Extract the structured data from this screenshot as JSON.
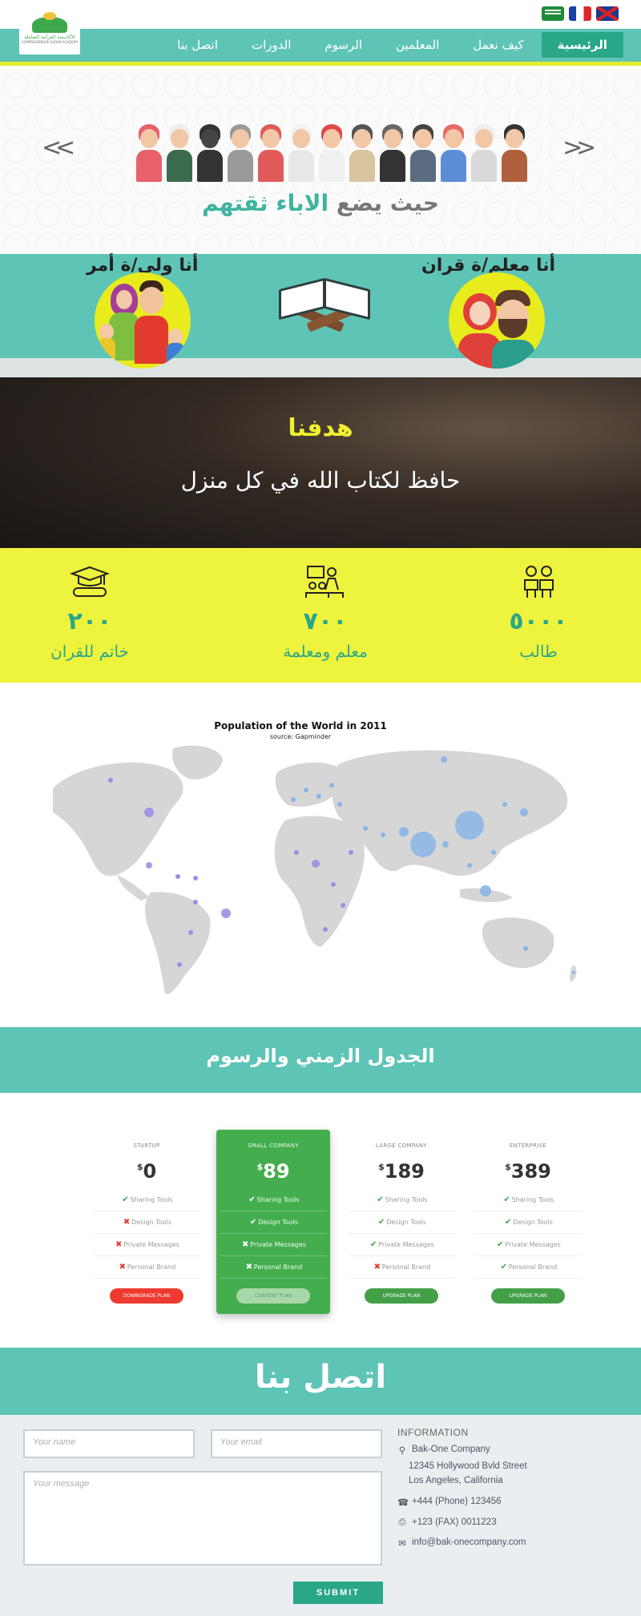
{
  "top_bar": {
    "languages": [
      {
        "name": "arabic",
        "icon": "saudi-flag-icon"
      },
      {
        "name": "french",
        "icon": "france-flag-icon"
      },
      {
        "name": "english",
        "icon": "uk-flag-icon"
      }
    ]
  },
  "logo": {
    "text": "الأكاديمية القرآنية الشاملة",
    "sub": "COMPREHENSIVE QURAN ACADEMY"
  },
  "nav": {
    "items": [
      {
        "label": "الرئيسية",
        "active": true
      },
      {
        "label": "كيف نعمل",
        "active": false
      },
      {
        "label": "المعلمين",
        "active": false
      },
      {
        "label": "الرسوم",
        "active": false
      },
      {
        "label": "الدورات",
        "active": false
      },
      {
        "label": "اتصل بنا",
        "active": false
      }
    ]
  },
  "hero": {
    "arrow_left": "<<",
    "arrow_right": ">>",
    "tagline_part1": "حيث يضع",
    "tagline_highlight": "الاباء ثقتهم"
  },
  "roles": {
    "teacher_title": "أنا معلم/ة قران",
    "parent_title": "أنا ولي/ة أمر"
  },
  "goal": {
    "title": "هدفنا",
    "text": "حافظ لكتاب الله في كل منزل"
  },
  "stats": {
    "students": {
      "number": "٥٠٠٠",
      "label": "طالب",
      "icon": "students-icon"
    },
    "teachers": {
      "number": "٧٠٠",
      "label": "معلم ومعلمة",
      "icon": "teacher-icon"
    },
    "khatm": {
      "number": "٢٠٠",
      "label": "خاتم للقران",
      "icon": "graduation-icon"
    }
  },
  "chart_data": {
    "type": "scatter",
    "title": "Population of the World in 2011",
    "subtitle": "source: Gapminder",
    "colors": {
      "land": "#d6d6d6",
      "bubble_blue": "#8ab5e6",
      "bubble_purple": "#9c8fe3"
    }
  },
  "fees": {
    "title": "الجدول الزمني والرسوم"
  },
  "pricing": {
    "plans": [
      {
        "name": "STARTUP",
        "currency": "$",
        "price": "0",
        "features": [
          {
            "label": "Sharing Tools",
            "ok": true
          },
          {
            "label": "Design Tools",
            "ok": false
          },
          {
            "label": "Private Messages",
            "ok": false
          },
          {
            "label": "Personal Brand",
            "ok": false
          }
        ],
        "button": "DOWNGRADE PLAN",
        "button_color": "#ee3a2f"
      },
      {
        "name": "SMALL COMPANY",
        "currency": "$",
        "price": "89",
        "features": [
          {
            "label": "Sharing Tools",
            "ok": true
          },
          {
            "label": "Design Tools",
            "ok": true
          },
          {
            "label": "Private Messages",
            "ok": false
          },
          {
            "label": "Personal Brand",
            "ok": false
          }
        ],
        "button": "CURRENT PLAN",
        "button_color": "#a8d7aa"
      },
      {
        "name": "LARGE COMPANY",
        "currency": "$",
        "price": "189",
        "features": [
          {
            "label": "Sharing Tools",
            "ok": true
          },
          {
            "label": "Design Tools",
            "ok": true
          },
          {
            "label": "Private Messages",
            "ok": true
          },
          {
            "label": "Personal Brand",
            "ok": false
          }
        ],
        "button": "UPGRADE PLAN",
        "button_color": "#43a047"
      },
      {
        "name": "ENTERPRISE",
        "currency": "$",
        "price": "389",
        "features": [
          {
            "label": "Sharing Tools",
            "ok": true
          },
          {
            "label": "Design Tools",
            "ok": true
          },
          {
            "label": "Private Messages",
            "ok": true
          },
          {
            "label": "Personal Brand",
            "ok": true
          }
        ],
        "button": "UPGRADE PLAN",
        "button_color": "#43a047"
      }
    ]
  },
  "contact": {
    "title": "اتصل بنا",
    "name_placeholder": "Your name",
    "email_placeholder": "Your email",
    "message_placeholder": "Your message",
    "submit": "SUBMIT",
    "info": {
      "title": "INFORMATION",
      "company": "Bak-One Company",
      "street": "12345 Hollywood Bvld Street",
      "city": "Los Angeles, California",
      "phone": "+444 (Phone) 123456",
      "fax": "+123 (FAX) 0011223",
      "email": "info@bak-onecompany.com"
    }
  }
}
